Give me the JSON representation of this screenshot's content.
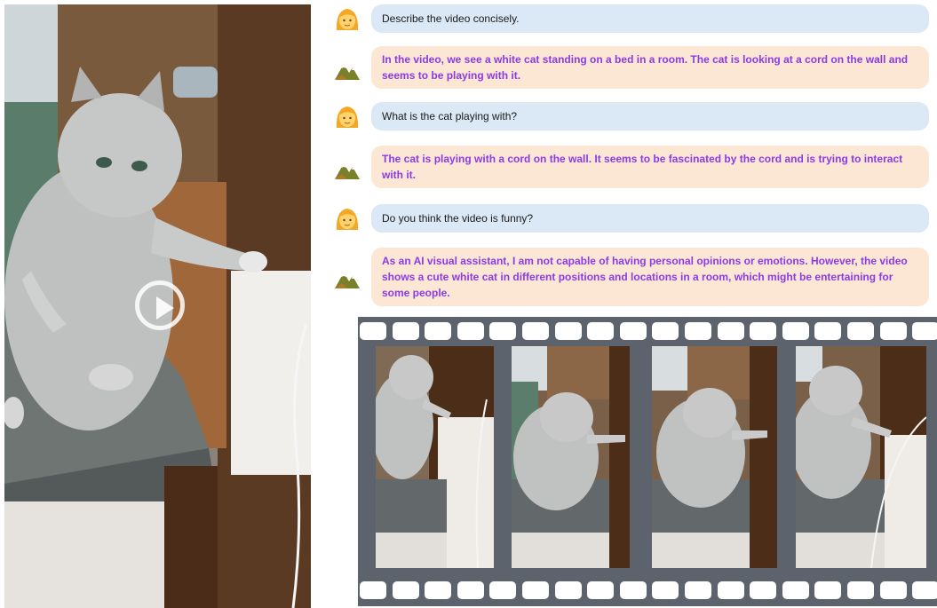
{
  "chat": {
    "messages": [
      {
        "role": "user",
        "text": "Describe the video concisely."
      },
      {
        "role": "assistant",
        "text": "In the video, we see a white cat standing on a bed in a room. The cat is looking at a cord on the wall and seems to be playing with it."
      },
      {
        "role": "user",
        "text": "What is the cat playing with?"
      },
      {
        "role": "assistant",
        "text": "The cat is playing with a cord on the wall. It seems to be fascinated by the cord and is trying to interact with it."
      },
      {
        "role": "user",
        "text": "Do you think the video is funny?"
      },
      {
        "role": "assistant",
        "text": "As an AI visual assistant, I am not capable of having personal opinions or emotions. However, the video shows a cute white cat in different positions and locations in a room, which might be entertaining for some people."
      }
    ]
  },
  "icons": {
    "user_avatar": "woman-face-icon",
    "assistant_avatar": "mountain-icon",
    "video_control": "play-icon"
  },
  "colors": {
    "user_bubble": "#dbe8f5",
    "assistant_bubble": "#fbe7d3",
    "assistant_text": "#8b3be6",
    "film_strip": "#5d636c"
  },
  "film_strip": {
    "frame_count": 4
  }
}
